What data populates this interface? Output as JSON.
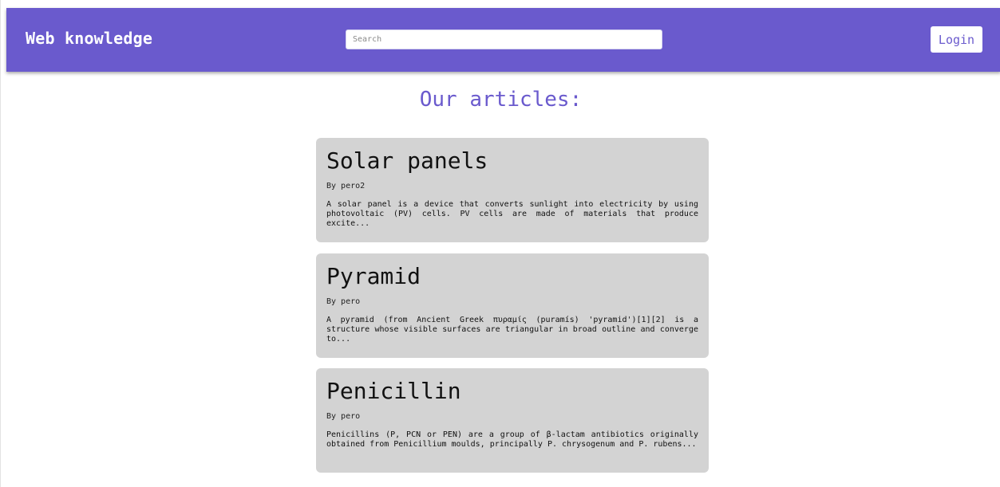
{
  "header": {
    "brand": "Web knowledge",
    "search_placeholder": "Search",
    "login_label": "Login"
  },
  "main": {
    "title": "Our articles:",
    "articles": [
      {
        "title": "Solar panels",
        "author": "By pero2",
        "excerpt": "A solar panel is a device that converts sunlight into electricity by using photovoltaic (PV) cells. PV cells are made of materials that produce excite..."
      },
      {
        "title": "Pyramid",
        "author": "By pero",
        "excerpt": "A pyramid (from Ancient Greek πυραμίς (puramís) 'pyramid')[1][2] is a structure whose visible surfaces are triangular in broad outline and converge to..."
      },
      {
        "title": "Penicillin",
        "author": "By pero",
        "excerpt": "Penicillins (P, PCN or PEN) are a group of β-lactam antibiotics originally obtained from Penicillium moulds, principally P. chrysogenum and P. rubens..."
      }
    ]
  },
  "colors": {
    "accent": "#6a5acd",
    "card_background": "#d3d3d3",
    "page_background": "#ffffff"
  }
}
